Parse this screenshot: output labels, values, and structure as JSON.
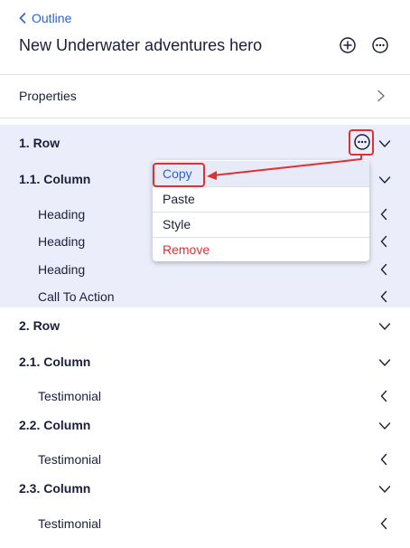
{
  "header": {
    "back_label": "Outline",
    "title": "New Underwater adventures hero",
    "add_icon": "plus-circle-icon",
    "more_icon": "ellipsis-circle-icon"
  },
  "properties": {
    "label": "Properties",
    "icon": "chevron-right-icon"
  },
  "tree": {
    "row1": "1. Row",
    "col1_1": "1.1. Column",
    "heading_1": "Heading",
    "heading_2": "Heading",
    "heading_3": "Heading",
    "cta": "Call To Action",
    "row2": "2. Row",
    "col2_1": "2.1. Column",
    "testimonial_1": "Testimonial",
    "col2_2": "2.2. Column",
    "testimonial_2": "Testimonial",
    "col2_3": "2.3. Column",
    "testimonial_3": "Testimonial"
  },
  "context_menu": {
    "copy": "Copy",
    "paste": "Paste",
    "style": "Style",
    "remove": "Remove"
  },
  "colors": {
    "accent": "#2962d9",
    "highlight_bg": "#ecedfb",
    "annotation": "#e0302f",
    "danger": "#e0302f",
    "text": "#1b1f3b"
  }
}
